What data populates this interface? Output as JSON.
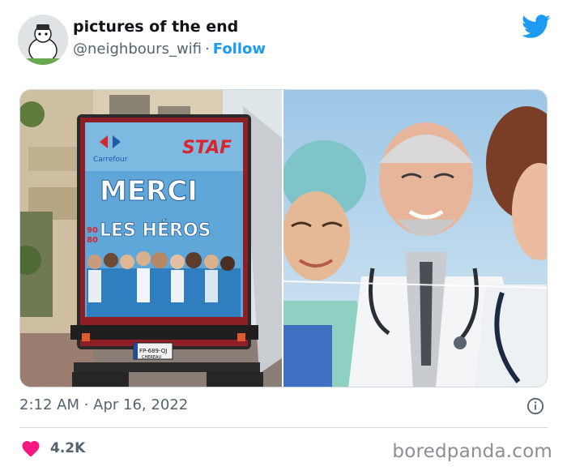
{
  "tweet": {
    "display_name": "pictures of the end",
    "handle": "@neighbours_wifi",
    "separator": "·",
    "follow_label": "Follow",
    "timestamp": "2:12 AM · Apr 16, 2022",
    "likes_count": "4.2K"
  },
  "media": {
    "truck_brand": "STAF",
    "store_name": "Carrefour",
    "headline_1": "MERCI",
    "headline_2": "LES HÉROS",
    "number_top": "90",
    "number_bottom": "80",
    "license_plate": "FP-689-QJ",
    "plate_city": "CHEREAU"
  },
  "footer": {
    "watermark": "boredpanda.com"
  },
  "colors": {
    "twitter_blue": "#1d9bf0",
    "like_pink": "#f91880",
    "text_primary": "#0f1419",
    "text_secondary": "#536471"
  },
  "icons": {
    "platform": "twitter-bird-icon",
    "like": "heart-icon",
    "info": "info-icon"
  }
}
